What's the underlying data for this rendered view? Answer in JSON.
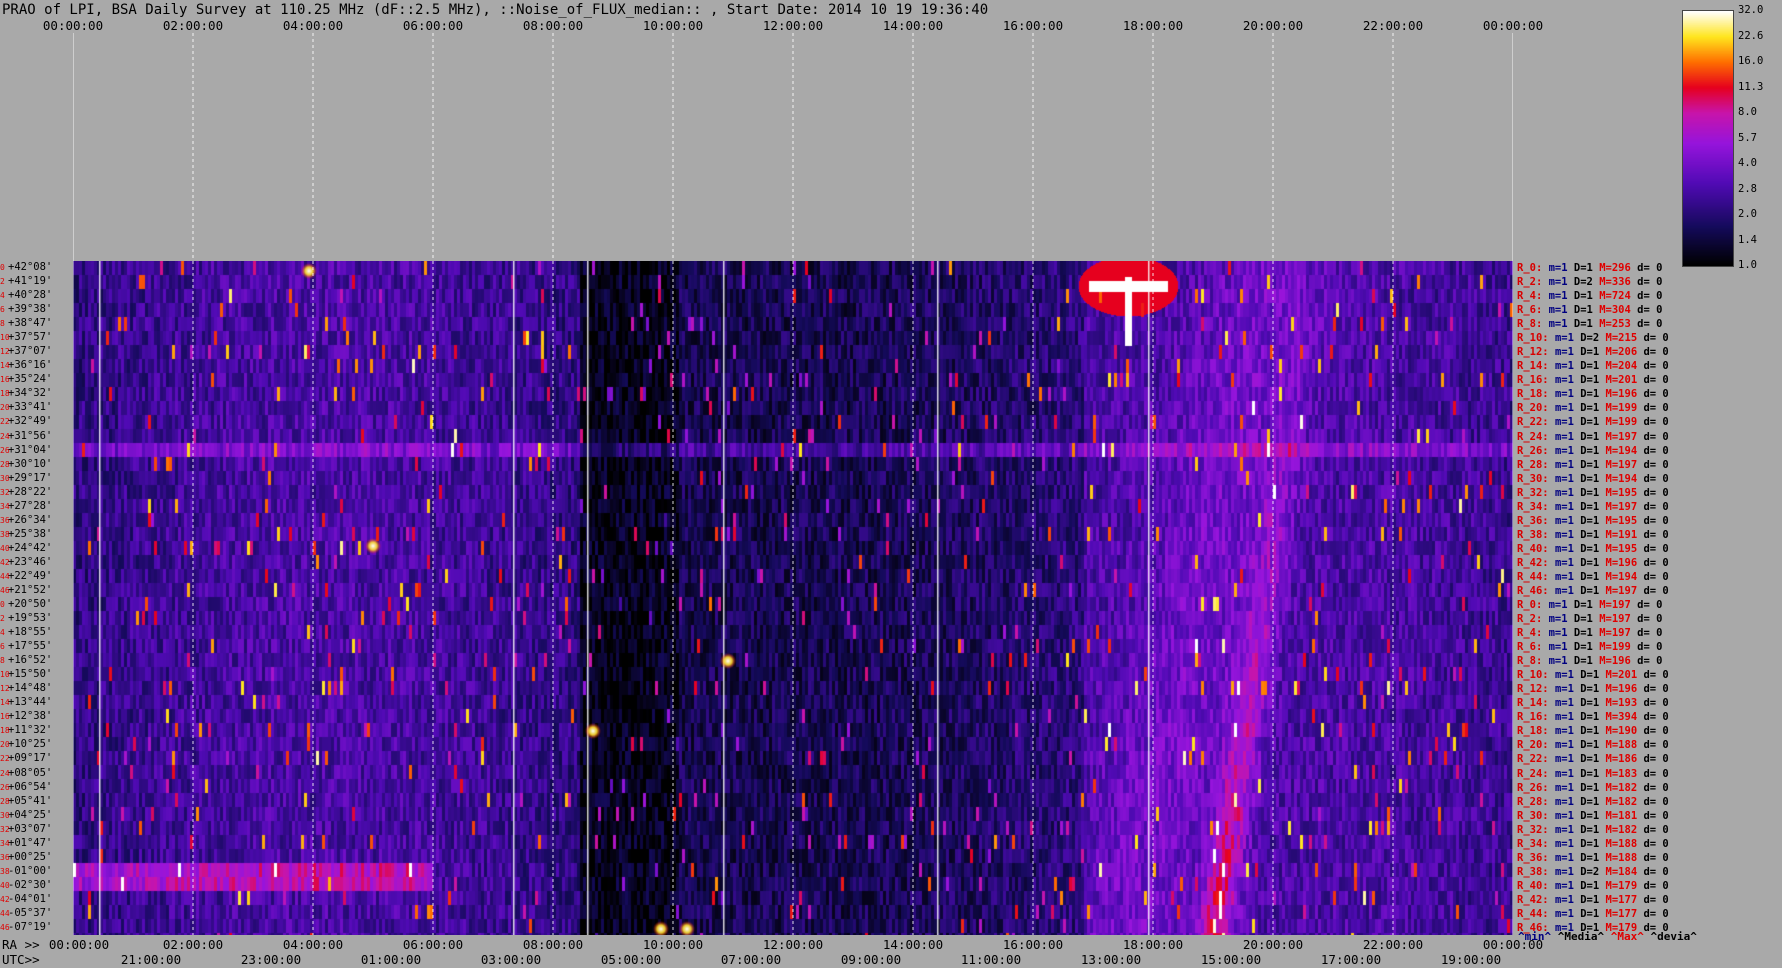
{
  "title": "PRAO of LPI, BSA Daily Survey at 110.25 MHz (dF::2.5 MHz), ::Noise_of_FLUX_median:: , Start Date: 2014 10 19 19:36:40",
  "chart_data": {
    "type": "heatmap",
    "top_ticks": [
      "00:00:00",
      "02:00:00",
      "04:00:00",
      "06:00:00",
      "08:00:00",
      "10:00:00",
      "12:00:00",
      "14:00:00",
      "16:00:00",
      "18:00:00",
      "20:00:00",
      "22:00:00",
      "00:00:00"
    ],
    "ra_prefix": "RA >>",
    "ra_ticks": [
      "00:00:00",
      "02:00:00",
      "04:00:00",
      "06:00:00",
      "08:00:00",
      "10:00:00",
      "12:00:00",
      "14:00:00",
      "16:00:00",
      "18:00:00",
      "20:00:00",
      "22:00:00",
      "00:00:00"
    ],
    "utc_prefix": "UTC>>",
    "utc_ticks": [
      "21:00:00",
      "23:00:00",
      "01:00:00",
      "03:00:00",
      "05:00:00",
      "07:00:00",
      "09:00:00",
      "11:00:00",
      "13:00:00",
      "15:00:00",
      "17:00:00",
      "19:00:00"
    ],
    "declinations": [
      "+42°08'",
      "+41°19'",
      "+40°28'",
      "+39°38'",
      "+38°47'",
      "+37°57'",
      "+37°07'",
      "+36°16'",
      "+35°24'",
      "+34°32'",
      "+33°41'",
      "+32°49'",
      "+31°56'",
      "+31°04'",
      "+30°10'",
      "+29°17'",
      "+28°22'",
      "+27°28'",
      "+26°34'",
      "+25°38'",
      "+24°42'",
      "+23°46'",
      "+22°49'",
      "+21°52'",
      "+20°50'",
      "+19°53'",
      "+18°55'",
      "+17°55'",
      "+16°52'",
      "+15°50'",
      "+14°48'",
      "+13°44'",
      "+12°38'",
      "+11°32'",
      "+10°25'",
      "+09°17'",
      "+08°05'",
      "+06°54'",
      "+05°41'",
      "+04°25'",
      "+03°07'",
      "+01°47'",
      "+00°25'",
      "-01°00'",
      "-02°30'",
      "-04°01'",
      "-05°37'",
      "-07°19'"
    ],
    "dec_indices": [
      "0",
      "2",
      "4",
      "6",
      "8",
      "10",
      "12",
      "14",
      "16",
      "18",
      "20",
      "22",
      "24",
      "26",
      "28",
      "30",
      "32",
      "34",
      "36",
      "38",
      "40",
      "42",
      "44",
      "46",
      "0",
      "2",
      "4",
      "6",
      "8",
      "10",
      "12",
      "14",
      "16",
      "18",
      "20",
      "22",
      "24",
      "26",
      "28",
      "30",
      "32",
      "34",
      "36",
      "38",
      "40",
      "42",
      "44",
      "46"
    ],
    "row_stats": [
      {
        "r": "R_0:",
        "min": "m=1",
        "med": "D=1",
        "max": "M=296",
        "dev": "d= 0"
      },
      {
        "r": "R_2:",
        "min": "m=1",
        "med": "D=2",
        "max": "M=336",
        "dev": "d= 0"
      },
      {
        "r": "R_4:",
        "min": "m=1",
        "med": "D=1",
        "max": "M=724",
        "dev": "d= 0"
      },
      {
        "r": "R_6:",
        "min": "m=1",
        "med": "D=1",
        "max": "M=304",
        "dev": "d= 0"
      },
      {
        "r": "R_8:",
        "min": "m=1",
        "med": "D=1",
        "max": "M=253",
        "dev": "d= 0"
      },
      {
        "r": "R_10:",
        "min": "m=1",
        "med": "D=2",
        "max": "M=215",
        "dev": "d= 0"
      },
      {
        "r": "R_12:",
        "min": "m=1",
        "med": "D=1",
        "max": "M=206",
        "dev": "d= 0"
      },
      {
        "r": "R_14:",
        "min": "m=1",
        "med": "D=1",
        "max": "M=204",
        "dev": "d= 0"
      },
      {
        "r": "R_16:",
        "min": "m=1",
        "med": "D=1",
        "max": "M=201",
        "dev": "d= 0"
      },
      {
        "r": "R_18:",
        "min": "m=1",
        "med": "D=1",
        "max": "M=196",
        "dev": "d= 0"
      },
      {
        "r": "R_20:",
        "min": "m=1",
        "med": "D=1",
        "max": "M=199",
        "dev": "d= 0"
      },
      {
        "r": "R_22:",
        "min": "m=1",
        "med": "D=1",
        "max": "M=199",
        "dev": "d= 0"
      },
      {
        "r": "R_24:",
        "min": "m=1",
        "med": "D=1",
        "max": "M=197",
        "dev": "d= 0"
      },
      {
        "r": "R_26:",
        "min": "m=1",
        "med": "D=1",
        "max": "M=194",
        "dev": "d= 0"
      },
      {
        "r": "R_28:",
        "min": "m=1",
        "med": "D=1",
        "max": "M=197",
        "dev": "d= 0"
      },
      {
        "r": "R_30:",
        "min": "m=1",
        "med": "D=1",
        "max": "M=194",
        "dev": "d= 0"
      },
      {
        "r": "R_32:",
        "min": "m=1",
        "med": "D=1",
        "max": "M=195",
        "dev": "d= 0"
      },
      {
        "r": "R_34:",
        "min": "m=1",
        "med": "D=1",
        "max": "M=197",
        "dev": "d= 0"
      },
      {
        "r": "R_36:",
        "min": "m=1",
        "med": "D=1",
        "max": "M=195",
        "dev": "d= 0"
      },
      {
        "r": "R_38:",
        "min": "m=1",
        "med": "D=1",
        "max": "M=191",
        "dev": "d= 0"
      },
      {
        "r": "R_40:",
        "min": "m=1",
        "med": "D=1",
        "max": "M=195",
        "dev": "d= 0"
      },
      {
        "r": "R_42:",
        "min": "m=1",
        "med": "D=1",
        "max": "M=196",
        "dev": "d= 0"
      },
      {
        "r": "R_44:",
        "min": "m=1",
        "med": "D=1",
        "max": "M=194",
        "dev": "d= 0"
      },
      {
        "r": "R_46:",
        "min": "m=1",
        "med": "D=1",
        "max": "M=197",
        "dev": "d= 0"
      },
      {
        "r": "R_0:",
        "min": "m=1",
        "med": "D=1",
        "max": "M=197",
        "dev": "d= 0"
      },
      {
        "r": "R_2:",
        "min": "m=1",
        "med": "D=1",
        "max": "M=197",
        "dev": "d= 0"
      },
      {
        "r": "R_4:",
        "min": "m=1",
        "med": "D=1",
        "max": "M=197",
        "dev": "d= 0"
      },
      {
        "r": "R_6:",
        "min": "m=1",
        "med": "D=1",
        "max": "M=199",
        "dev": "d= 0"
      },
      {
        "r": "R_8:",
        "min": "m=1",
        "med": "D=1",
        "max": "M=196",
        "dev": "d= 0"
      },
      {
        "r": "R_10:",
        "min": "m=1",
        "med": "D=1",
        "max": "M=201",
        "dev": "d= 0"
      },
      {
        "r": "R_12:",
        "min": "m=1",
        "med": "D=1",
        "max": "M=196",
        "dev": "d= 0"
      },
      {
        "r": "R_14:",
        "min": "m=1",
        "med": "D=1",
        "max": "M=193",
        "dev": "d= 0"
      },
      {
        "r": "R_16:",
        "min": "m=1",
        "med": "D=1",
        "max": "M=394",
        "dev": "d= 0"
      },
      {
        "r": "R_18:",
        "min": "m=1",
        "med": "D=1",
        "max": "M=190",
        "dev": "d= 0"
      },
      {
        "r": "R_20:",
        "min": "m=1",
        "med": "D=1",
        "max": "M=188",
        "dev": "d= 0"
      },
      {
        "r": "R_22:",
        "min": "m=1",
        "med": "D=1",
        "max": "M=186",
        "dev": "d= 0"
      },
      {
        "r": "R_24:",
        "min": "m=1",
        "med": "D=1",
        "max": "M=183",
        "dev": "d= 0"
      },
      {
        "r": "R_26:",
        "min": "m=1",
        "med": "D=1",
        "max": "M=182",
        "dev": "d= 0"
      },
      {
        "r": "R_28:",
        "min": "m=1",
        "med": "D=1",
        "max": "M=182",
        "dev": "d= 0"
      },
      {
        "r": "R_30:",
        "min": "m=1",
        "med": "D=1",
        "max": "M=181",
        "dev": "d= 0"
      },
      {
        "r": "R_32:",
        "min": "m=1",
        "med": "D=1",
        "max": "M=182",
        "dev": "d= 0"
      },
      {
        "r": "R_34:",
        "min": "m=1",
        "med": "D=1",
        "max": "M=188",
        "dev": "d= 0"
      },
      {
        "r": "R_36:",
        "min": "m=1",
        "med": "D=1",
        "max": "M=188",
        "dev": "d= 0"
      },
      {
        "r": "R_38:",
        "min": "m=1",
        "med": "D=2",
        "max": "M=184",
        "dev": "d= 0"
      },
      {
        "r": "R_40:",
        "min": "m=1",
        "med": "D=1",
        "max": "M=179",
        "dev": "d= 0"
      },
      {
        "r": "R_42:",
        "min": "m=1",
        "med": "D=1",
        "max": "M=177",
        "dev": "d= 0"
      },
      {
        "r": "R_44:",
        "min": "m=1",
        "med": "D=1",
        "max": "M=177",
        "dev": "d= 0"
      },
      {
        "r": "R_46:",
        "min": "m=1",
        "med": "D=1",
        "max": "M=179",
        "dev": "d= 0"
      }
    ],
    "stats_legend": {
      "min": "^min^",
      "median": "^Media^",
      "max": "^Max^",
      "dev": "^devia^"
    },
    "colorbar": {
      "ticks": [
        "32.0",
        "22.6",
        "16.0",
        "11.3",
        "8.0",
        "5.7",
        "4.0",
        "2.8",
        "2.0",
        "1.4",
        "1.0"
      ],
      "range": [
        1.0,
        32.0
      ],
      "scale": "log"
    },
    "colors": {
      "background": "#a9a9a9",
      "low": "#000000",
      "mid": "#7a10d0",
      "high_red": "#e00000",
      "top": "#ffffff",
      "title_red": "#e00000"
    }
  }
}
